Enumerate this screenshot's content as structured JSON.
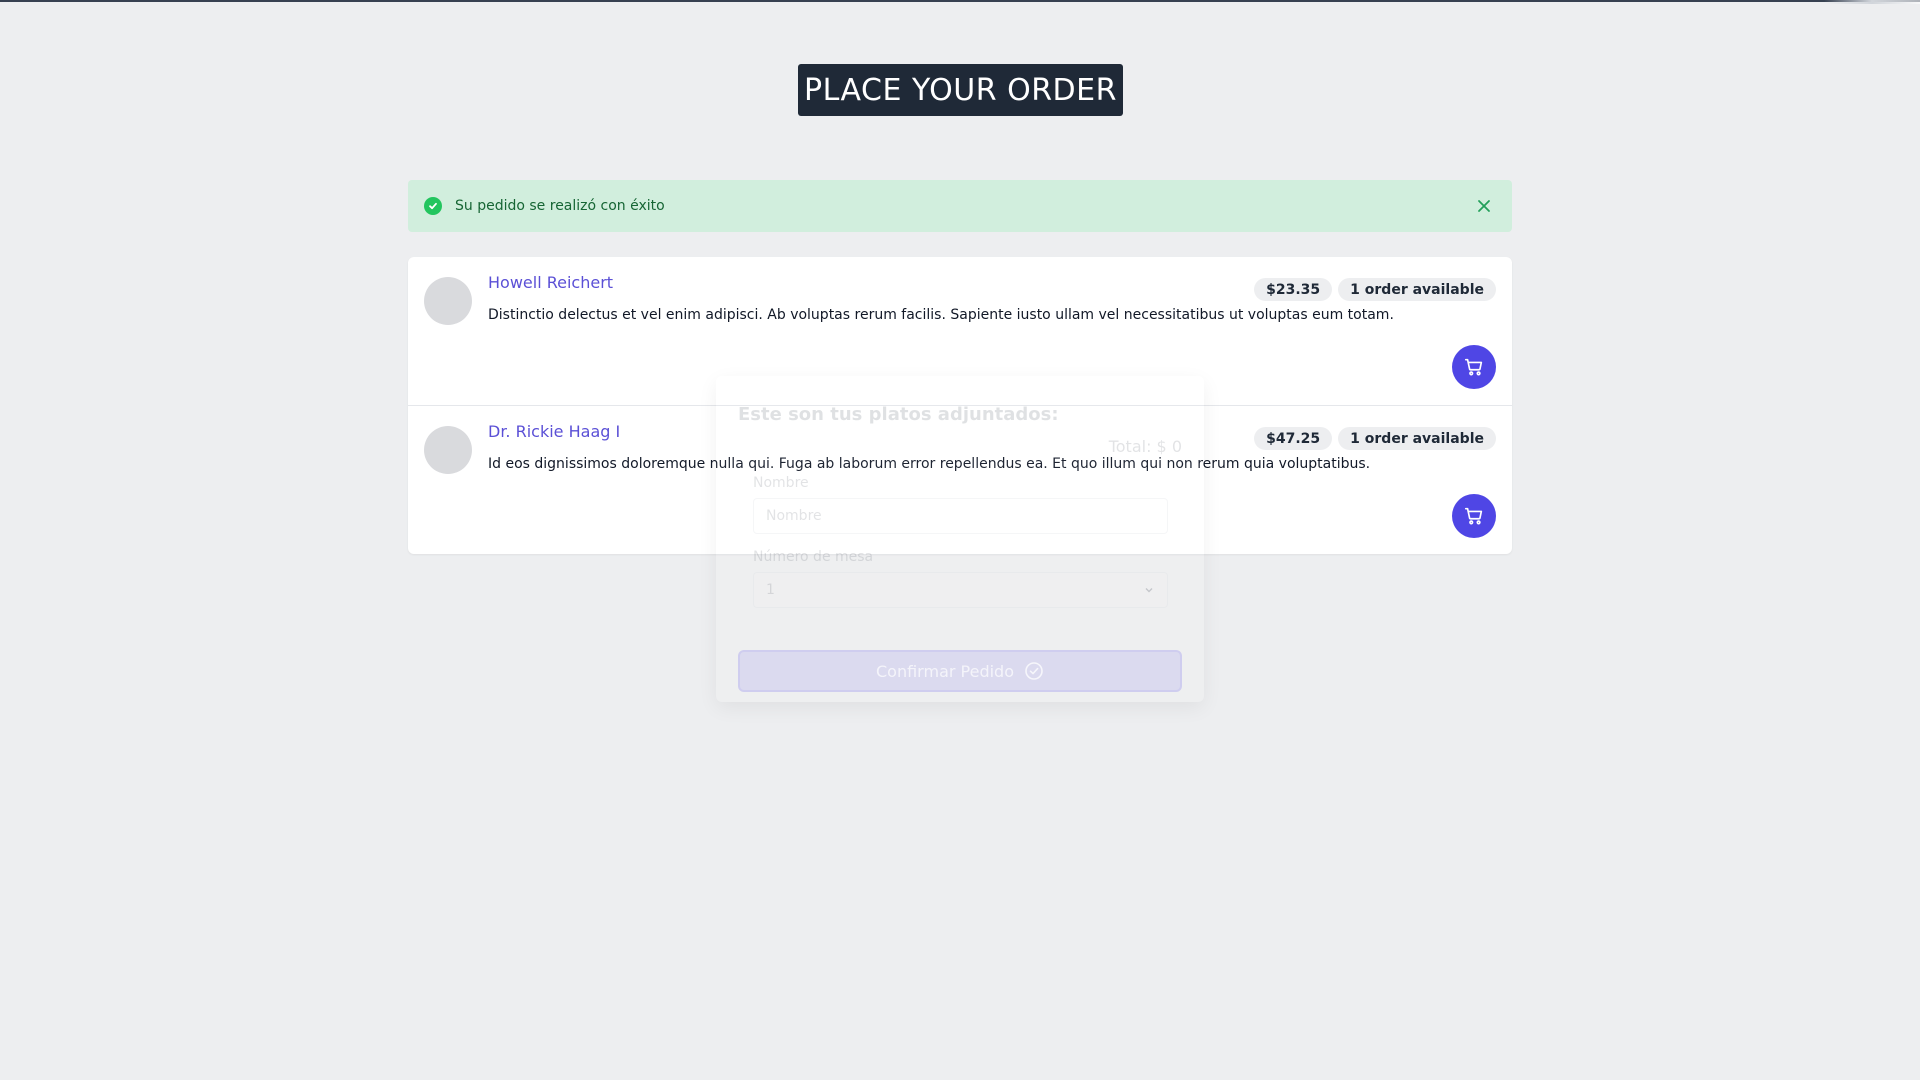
{
  "header": {
    "title": "PLACE YOUR ORDER"
  },
  "alert": {
    "message": "Su pedido se realizó con éxito",
    "icon": "check-circle-icon",
    "close_icon": "close-icon",
    "color": "#22c55e"
  },
  "dishes": [
    {
      "name": "Howell Reichert",
      "description": "Distinctio delectus et vel enim adipisci. Ab voluptas rerum facilis. Sapiente iusto ullam vel necessitatibus ut voluptas eum totam.",
      "price": "$23.35",
      "availability": "1 order available",
      "action_icon": "cart-icon"
    },
    {
      "name": "Dr. Rickie Haag I",
      "description": "Id eos dignissimos doloremque nulla qui. Fuga ab laborum error repellendus ea. Et quo illum qui non rerum quia voluptatibus.",
      "price": "$47.25",
      "availability": "1 order available",
      "action_icon": "cart-icon"
    }
  ],
  "order_modal": {
    "title": "Este son tus platos adjuntados:",
    "total": "Total: $ 0",
    "name_label": "Nombre",
    "name_placeholder": "Nombre",
    "table_label": "Número de mesa",
    "table_value": "1",
    "confirm_label": "Confirmar Pedido"
  },
  "colors": {
    "accent": "#4f46e5",
    "link": "#5b50d6",
    "title_bg": "#1f2937",
    "alert_bg": "#d1eedd"
  }
}
